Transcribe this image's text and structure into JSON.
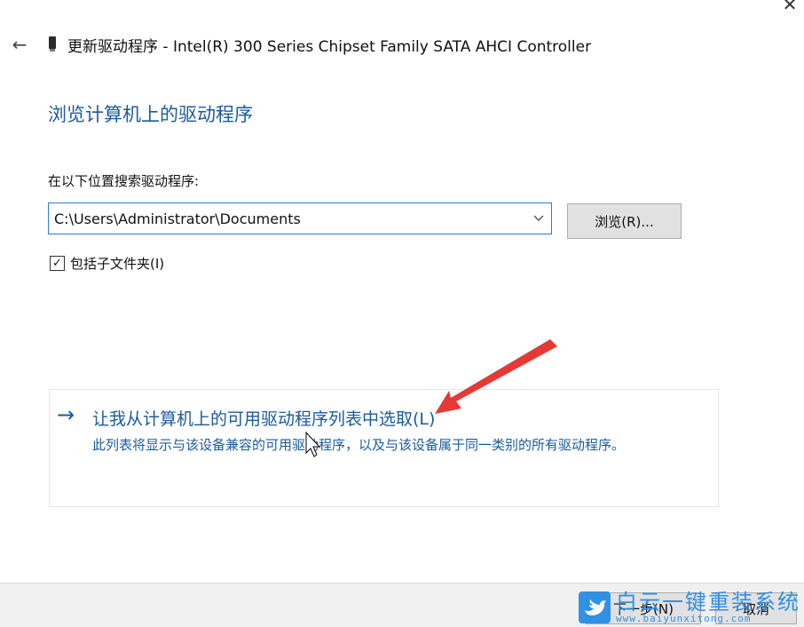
{
  "window": {
    "title": "更新驱动程序 - Intel(R) 300 Series Chipset Family SATA AHCI Controller",
    "close_glyph": "✕",
    "back_glyph": "←"
  },
  "page": {
    "heading": "浏览计算机上的驱动程序",
    "search_label": "在以下位置搜索驱动程序:",
    "path_value": "C:\\Users\\Administrator\\Documents",
    "browse_label": "浏览(R)...",
    "include_subfolders": {
      "checked": true,
      "mark": "✓",
      "label": "包括子文件夹(I)"
    }
  },
  "pick_option": {
    "arrow": "→",
    "title": "让我从计算机上的可用驱动程序列表中选取(L)",
    "description": "此列表将显示与该设备兼容的可用驱动程序，以及与该设备属于同一类别的所有驱动程序。"
  },
  "footer": {
    "next_label": "下一步(N)",
    "cancel_label": "取消"
  },
  "watermark": {
    "brand": "白云一键重装系统",
    "url": "www.baiyunxitong.com"
  },
  "colors": {
    "accent_blue": "#1b5b9c",
    "focus_border": "#2d7dd2",
    "annotation_red": "#e53935",
    "watermark_blue": "#1e88e5"
  }
}
